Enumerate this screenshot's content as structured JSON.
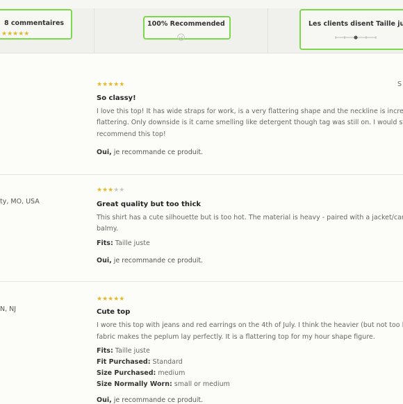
{
  "summary": {
    "reviews_count_label": "8 commentaires",
    "reviews_stars": 5,
    "recommended_label": "100% Recommended",
    "fit_label": "Les clients disent Taille juste"
  },
  "reviews": [
    {
      "stars": 5,
      "title": "So classy!",
      "body_lines": [
        "I love this top! It has wide straps for work, is a very flattering shape and the neckline is incred",
        "flattering. Only downside is it came smelling like detergent though tag was still on. I would st",
        "recommend this top!"
      ],
      "recommend_yes": "Oui,",
      "recommend_text": " je recommande ce produit.",
      "edge_letter": "S"
    },
    {
      "stars": 3,
      "location": "ty, MO, USA",
      "title": "Great quality but too thick",
      "body_lines": [
        "This shirt has a cute silhouette but is too hot. The material is heavy - paired with a jacket/card",
        "balmy."
      ],
      "fits_label": "Fits:",
      "fits_value": " Taille juste",
      "recommend_yes": "Oui,",
      "recommend_text": " je recommande ce produit."
    },
    {
      "stars": 5,
      "location": "N, NJ",
      "title": "Cute top",
      "body_lines": [
        "I wore this top with jeans and red earrings on the 4th of July. I think the heavier (but not too l",
        "fabric makes the peplum lay perfectly. It is a flattering top for my hour shape figure."
      ],
      "fits_label": "Fits:",
      "fits_value": " Taille juste",
      "fit_purchased_label": "Fit Purchased:",
      "fit_purchased_value": " Standard",
      "size_purchased_label": "Size Purchased:",
      "size_purchased_value": " medium",
      "size_worn_label": "Size Normally Worn:",
      "size_worn_value": " small or medium",
      "recommend_yes": "Oui,",
      "recommend_text": " je recommande ce produit."
    }
  ],
  "colors": {
    "highlight": "#7bd84a",
    "star": "#e3b92b",
    "star_off": "#c9c9c4"
  }
}
